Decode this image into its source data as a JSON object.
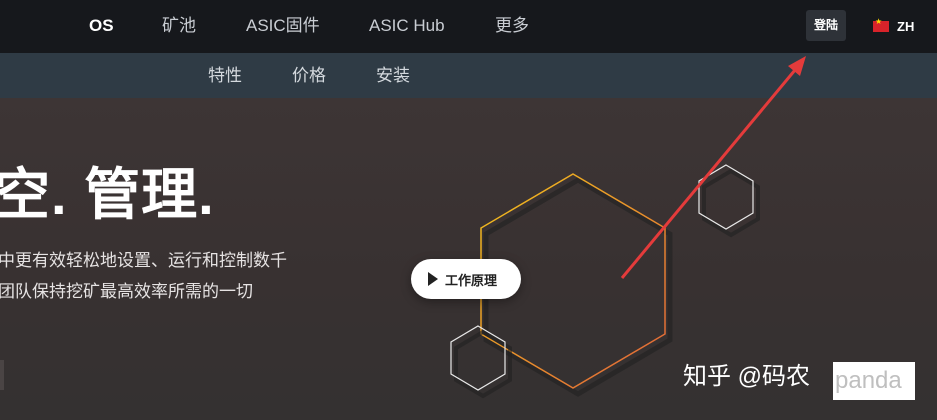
{
  "nav": {
    "items": [
      "OS",
      "矿池",
      "ASIC固件",
      "ASIC Hub",
      "更多"
    ],
    "login": "登陆",
    "lang": "ZH"
  },
  "subnav": {
    "items": [
      "特性",
      "价格",
      "安装"
    ]
  },
  "hero": {
    "headline": "空. 管理.",
    "desc_line1": "中更有效轻松地设置、运行和控制数千",
    "desc_line2": "团队保持挖矿最高效率所需的一切",
    "play_label": "工作原理"
  },
  "watermark": {
    "text": "知乎 @码农",
    "box_text": "panda"
  },
  "colors": {
    "nav_bg": "#16181c",
    "subnav_bg": "#2f3b45",
    "hero_bg": "#3a3333",
    "hex_gradient_start": "#f2c21b",
    "hex_gradient_end": "#e0623a",
    "arrow": "#e43b3b"
  },
  "icons": {
    "play": "play-icon",
    "flag": "china-flag-icon"
  }
}
